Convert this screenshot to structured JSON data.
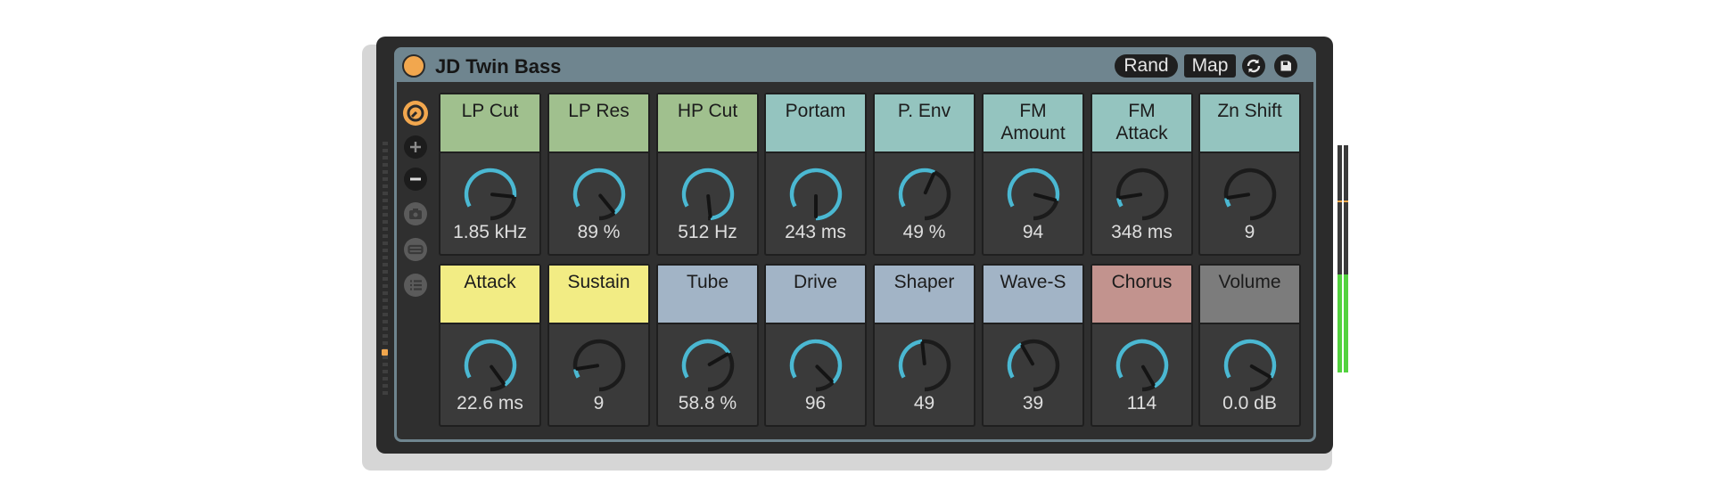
{
  "device": {
    "title": "JD Twin Bass",
    "buttons": {
      "rand": "Rand",
      "map": "Map"
    },
    "header_icons": [
      "randomize-icon",
      "save-icon"
    ],
    "sidebar_icons": [
      "hot-swap-icon",
      "add-icon",
      "remove-icon",
      "snapshot-icon",
      "chain-icon",
      "list-icon"
    ]
  },
  "colors": {
    "accent": "#f2a74e",
    "knob_arc": "#4bb8d2",
    "green": "#a0c08e",
    "teal": "#94c4bf",
    "yellow": "#f2ec84",
    "blue": "#a2b4c6",
    "red": "#c2938e",
    "gray": "#7c7c7c",
    "frame": "#6f858f",
    "meter": "#53d23f"
  },
  "macros": [
    {
      "label": "LP Cut",
      "value": "1.85 kHz",
      "color": "green",
      "level": 0.72
    },
    {
      "label": "LP Res",
      "value": "89 %",
      "color": "green",
      "level": 0.87
    },
    {
      "label": "HP Cut",
      "value": "512 Hz",
      "color": "green",
      "level": 0.98
    },
    {
      "label": "Portam",
      "value": "243 ms",
      "color": "teal",
      "level": 1.0
    },
    {
      "label": "P. Env",
      "value": "49 %",
      "color": "teal",
      "level": 0.48
    },
    {
      "label": "FM\nAmount",
      "value": "94",
      "color": "teal",
      "level": 0.75
    },
    {
      "label": "FM\nAttack",
      "value": "348 ms",
      "color": "teal",
      "level": 0.07
    },
    {
      "label": "Zn Shift",
      "value": "9",
      "color": "teal",
      "level": 0.07
    },
    {
      "label": "Attack",
      "value": "22.6 ms",
      "color": "yellow",
      "level": 0.88
    },
    {
      "label": "Sustain",
      "value": "9",
      "color": "yellow",
      "level": 0.07
    },
    {
      "label": "Tube",
      "value": "58.8 %",
      "color": "blue",
      "level": 0.6
    },
    {
      "label": "Drive",
      "value": "96",
      "color": "blue",
      "level": 0.85
    },
    {
      "label": "Shaper",
      "value": "49",
      "color": "blue",
      "level": 0.38
    },
    {
      "label": "Wave-S",
      "value": "39",
      "color": "blue",
      "level": 0.3
    },
    {
      "label": "Chorus",
      "value": "114",
      "color": "red",
      "level": 0.9
    },
    {
      "label": "Volume",
      "value": "0.0 dB",
      "color": "gray",
      "level": 0.8
    }
  ],
  "meter": {
    "left_level": 0.43,
    "right_level": 0.43
  }
}
